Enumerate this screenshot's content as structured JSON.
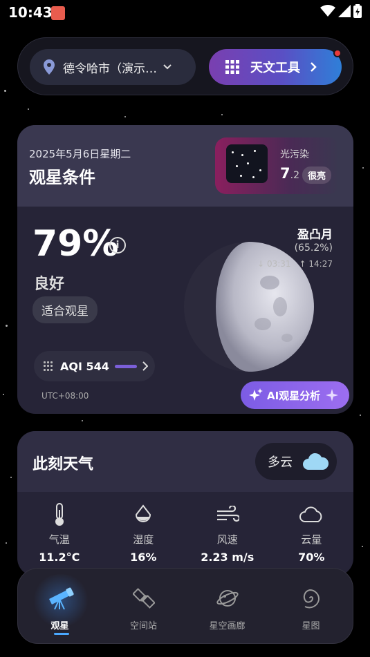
{
  "status_bar": {
    "time": "10:43"
  },
  "top_bar": {
    "location": "德令哈市（演示…",
    "tools_label": "天文工具"
  },
  "observation": {
    "date": "2025年5月6日星期二",
    "title": "观星条件",
    "light_pollution": {
      "label": "光污染",
      "value_int": "7",
      "value_dec": ".2",
      "badge": "很亮"
    },
    "percent": "79%",
    "quality": "良好",
    "suitable": "适合观星",
    "moon": {
      "phase": "盈凸月",
      "illumination": "(65.2%)",
      "set_time": "03:31",
      "rise_time": "14:27",
      "illumination_fraction": 0.652
    },
    "aqi": "AQI 544",
    "timezone": "UTC+08:00",
    "ai_button": "AI观星分析"
  },
  "weather": {
    "title": "此刻天气",
    "condition": "多云",
    "items": [
      {
        "label": "气温",
        "value": "11.2°C",
        "icon": "thermometer-icon"
      },
      {
        "label": "湿度",
        "value": "16%",
        "icon": "droplet-icon"
      },
      {
        "label": "风速",
        "value": "2.23 m/s",
        "icon": "wind-icon"
      },
      {
        "label": "云量",
        "value": "70%",
        "icon": "cloud-icon"
      }
    ]
  },
  "nav": {
    "items": [
      {
        "label": "观星",
        "icon": "telescope-icon",
        "active": true
      },
      {
        "label": "空间站",
        "icon": "satellite-icon",
        "active": false
      },
      {
        "label": "星空画廊",
        "icon": "planet-icon",
        "active": false
      },
      {
        "label": "星图",
        "icon": "galaxy-icon",
        "active": false
      }
    ]
  },
  "colors": {
    "accent": "#5a4fc4",
    "ai_button": "#8a66ea",
    "nav_active": "#4aa8ff",
    "notification": "#e83a3a"
  }
}
